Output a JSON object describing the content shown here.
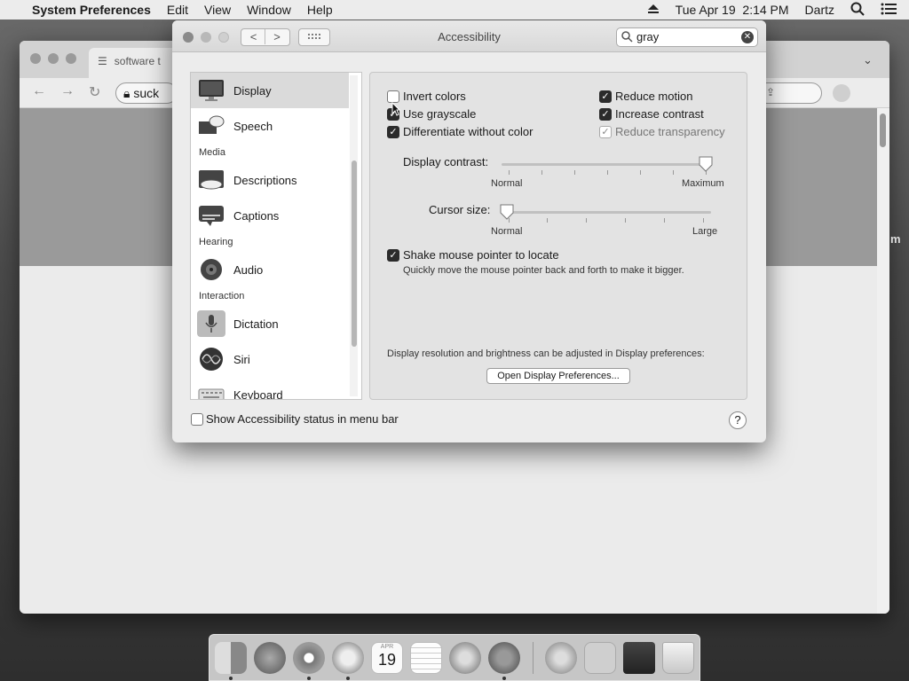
{
  "menubar": {
    "apple_glyph": "",
    "app_name": "System Preferences",
    "menus": [
      "Edit",
      "View",
      "Window",
      "Help"
    ],
    "clock": "Tue Apr 19  2:14 PM",
    "user": "Dartz",
    "icons": [
      "eject-icon",
      "spotlight-search-icon",
      "control-center-icon"
    ]
  },
  "browser": {
    "tab_title": "software t",
    "url_text": "suck",
    "right_edge_text": "m"
  },
  "window": {
    "title": "Accessibility",
    "search_value": "gray",
    "sidebar": {
      "items": [
        {
          "label": "Display",
          "selected": true,
          "icon": "display-monitor-icon"
        },
        {
          "label": "Speech",
          "icon": "speech-bubble-icon"
        },
        {
          "label": "Descriptions",
          "icon": "descriptions-icon"
        },
        {
          "label": "Captions",
          "icon": "captions-icon"
        },
        {
          "label": "Audio",
          "icon": "speaker-icon"
        },
        {
          "label": "Dictation",
          "icon": "microphone-icon"
        },
        {
          "label": "Siri",
          "icon": "siri-icon"
        },
        {
          "label": "Keyboard",
          "icon": "keyboard-icon"
        }
      ],
      "headers": [
        "Media",
        "Hearing",
        "Interaction"
      ]
    },
    "options": {
      "invert_colors": {
        "label": "Invert colors",
        "checked": false
      },
      "use_grayscale": {
        "label": "Use grayscale",
        "checked": true
      },
      "differentiate": {
        "label": "Differentiate without color",
        "checked": true
      },
      "reduce_motion": {
        "label": "Reduce motion",
        "checked": true
      },
      "increase_contrast": {
        "label": "Increase contrast",
        "checked": true
      },
      "reduce_transparency": {
        "label": "Reduce transparency",
        "checked": true,
        "disabled": true
      }
    },
    "display_contrast": {
      "label": "Display contrast:",
      "min_label": "Normal",
      "max_label": "Maximum",
      "value": 1.0
    },
    "cursor_size": {
      "label": "Cursor size:",
      "min_label": "Normal",
      "max_label": "Large",
      "value": 0.0
    },
    "shake": {
      "label": "Shake mouse pointer to locate",
      "checked": true,
      "description": "Quickly move the mouse pointer back and forth to make it bigger."
    },
    "resolution_note": "Display resolution and brightness can be adjusted in Display preferences:",
    "open_display_button": "Open Display Preferences...",
    "status_menu": {
      "label": "Show Accessibility status in menu bar",
      "checked": false
    },
    "help": "?"
  },
  "dock": {
    "apps": [
      "Finder",
      "Launchpad",
      "Chrome",
      "Safari",
      "Calendar",
      "Notes",
      "App Store",
      "System Preferences",
      "Downloads",
      "Downloads Folder",
      "Printer",
      "Trash"
    ],
    "calendar": {
      "month": "APR",
      "day": "19"
    }
  },
  "colors": {
    "accent": "#2b2b2b",
    "window_bg": "#ececec",
    "selected_row": "#dadada"
  }
}
